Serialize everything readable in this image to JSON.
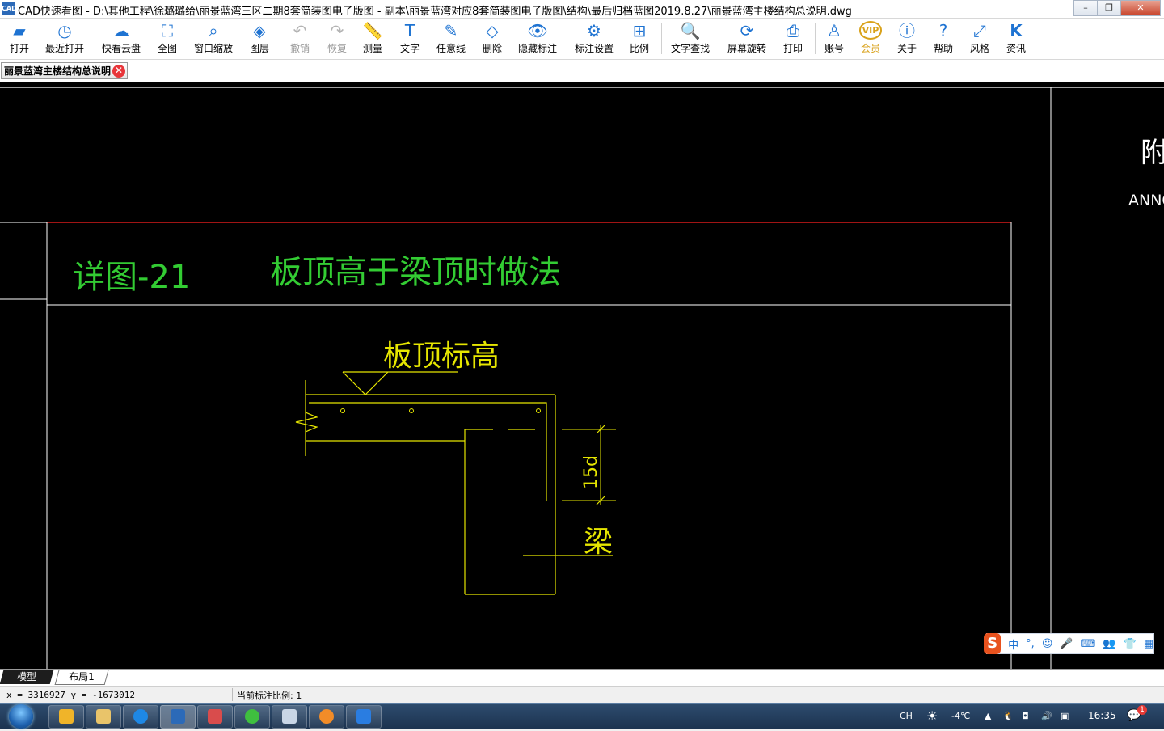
{
  "window": {
    "app_icon": "CAD",
    "title": "CAD快速看图 - D:\\其他工程\\徐璐璐给\\丽景蓝湾三区二期8套简装图电子版图 - 副本\\丽景蓝湾对应8套简装图电子版图\\结构\\最后归档蓝图2019.8.27\\丽景蓝湾主楼结构总说明.dwg",
    "minimize": "–",
    "maximize": "❐",
    "close": "✕"
  },
  "toolbar": {
    "open": {
      "label": "打开",
      "icon": "folder-icon"
    },
    "recent": {
      "label": "最近打开",
      "icon": "clock-icon"
    },
    "cloud": {
      "label": "快看云盘",
      "icon": "cloud-icon"
    },
    "fullview": {
      "label": "全图",
      "icon": "fullview-icon"
    },
    "window_zoom": {
      "label": "窗口缩放",
      "icon": "zoom-window-icon"
    },
    "layers": {
      "label": "图层",
      "icon": "layers-icon"
    },
    "undo": {
      "label": "撤销",
      "icon": "undo-icon"
    },
    "redo": {
      "label": "恢复",
      "icon": "redo-icon"
    },
    "measure": {
      "label": "测量",
      "icon": "ruler-icon"
    },
    "text": {
      "label": "文字",
      "icon": "text-icon"
    },
    "freeline": {
      "label": "任意线",
      "icon": "pen-icon"
    },
    "delete": {
      "label": "删除",
      "icon": "eraser-icon"
    },
    "hide_annot": {
      "label": "隐藏标注",
      "icon": "eye-slash-icon"
    },
    "annot_settings": {
      "label": "标注设置",
      "icon": "settings-pen-icon"
    },
    "ratio": {
      "label": "比例",
      "icon": "ratio-icon"
    },
    "text_search": {
      "label": "文字查找",
      "icon": "text-search-icon"
    },
    "rotate": {
      "label": "屏幕旋转",
      "icon": "rotate-screen-icon"
    },
    "print": {
      "label": "打印",
      "icon": "printer-icon"
    },
    "account": {
      "label": "账号",
      "icon": "user-icon"
    },
    "vip": {
      "label": "会员",
      "icon": "vip-icon",
      "badge": "VIP"
    },
    "about": {
      "label": "关于",
      "icon": "info-icon"
    },
    "help": {
      "label": "帮助",
      "icon": "help-icon"
    },
    "style": {
      "label": "风格",
      "icon": "style-icon"
    },
    "news": {
      "label": "资讯",
      "icon": "news-icon"
    }
  },
  "doc_tab": {
    "label": "丽景蓝湾主楼结构总说明",
    "close": "✕"
  },
  "drawing": {
    "detail_no": "详图-21",
    "detail_title": "板顶高于梁顶时做法",
    "slab_top_label": "板顶标高",
    "dim_label": "15d",
    "beam_label": "梁",
    "right_char": "附",
    "right_text": "ANNO",
    "colors": {
      "text_green": "#33cc33",
      "line_yellow": "#e6e600",
      "line_white": "#ffffff",
      "line_red": "#ff2020"
    }
  },
  "ime": {
    "logo": "S",
    "lang": "中",
    "punct": "°,",
    "emoji": "☺",
    "mic": "🎤",
    "keyboard": "⌨",
    "users": "👥",
    "shirt": "👕",
    "grid": "▦"
  },
  "layout_tabs": {
    "model": "模型",
    "layout1": "布局1"
  },
  "status": {
    "coords": "x = 3316927  y = -1673012",
    "scale": "当前标注比例: 1"
  },
  "taskbar": {
    "tray_lang": "CH",
    "weather": "-4℃",
    "time": "16:35",
    "notif_count": "1"
  }
}
